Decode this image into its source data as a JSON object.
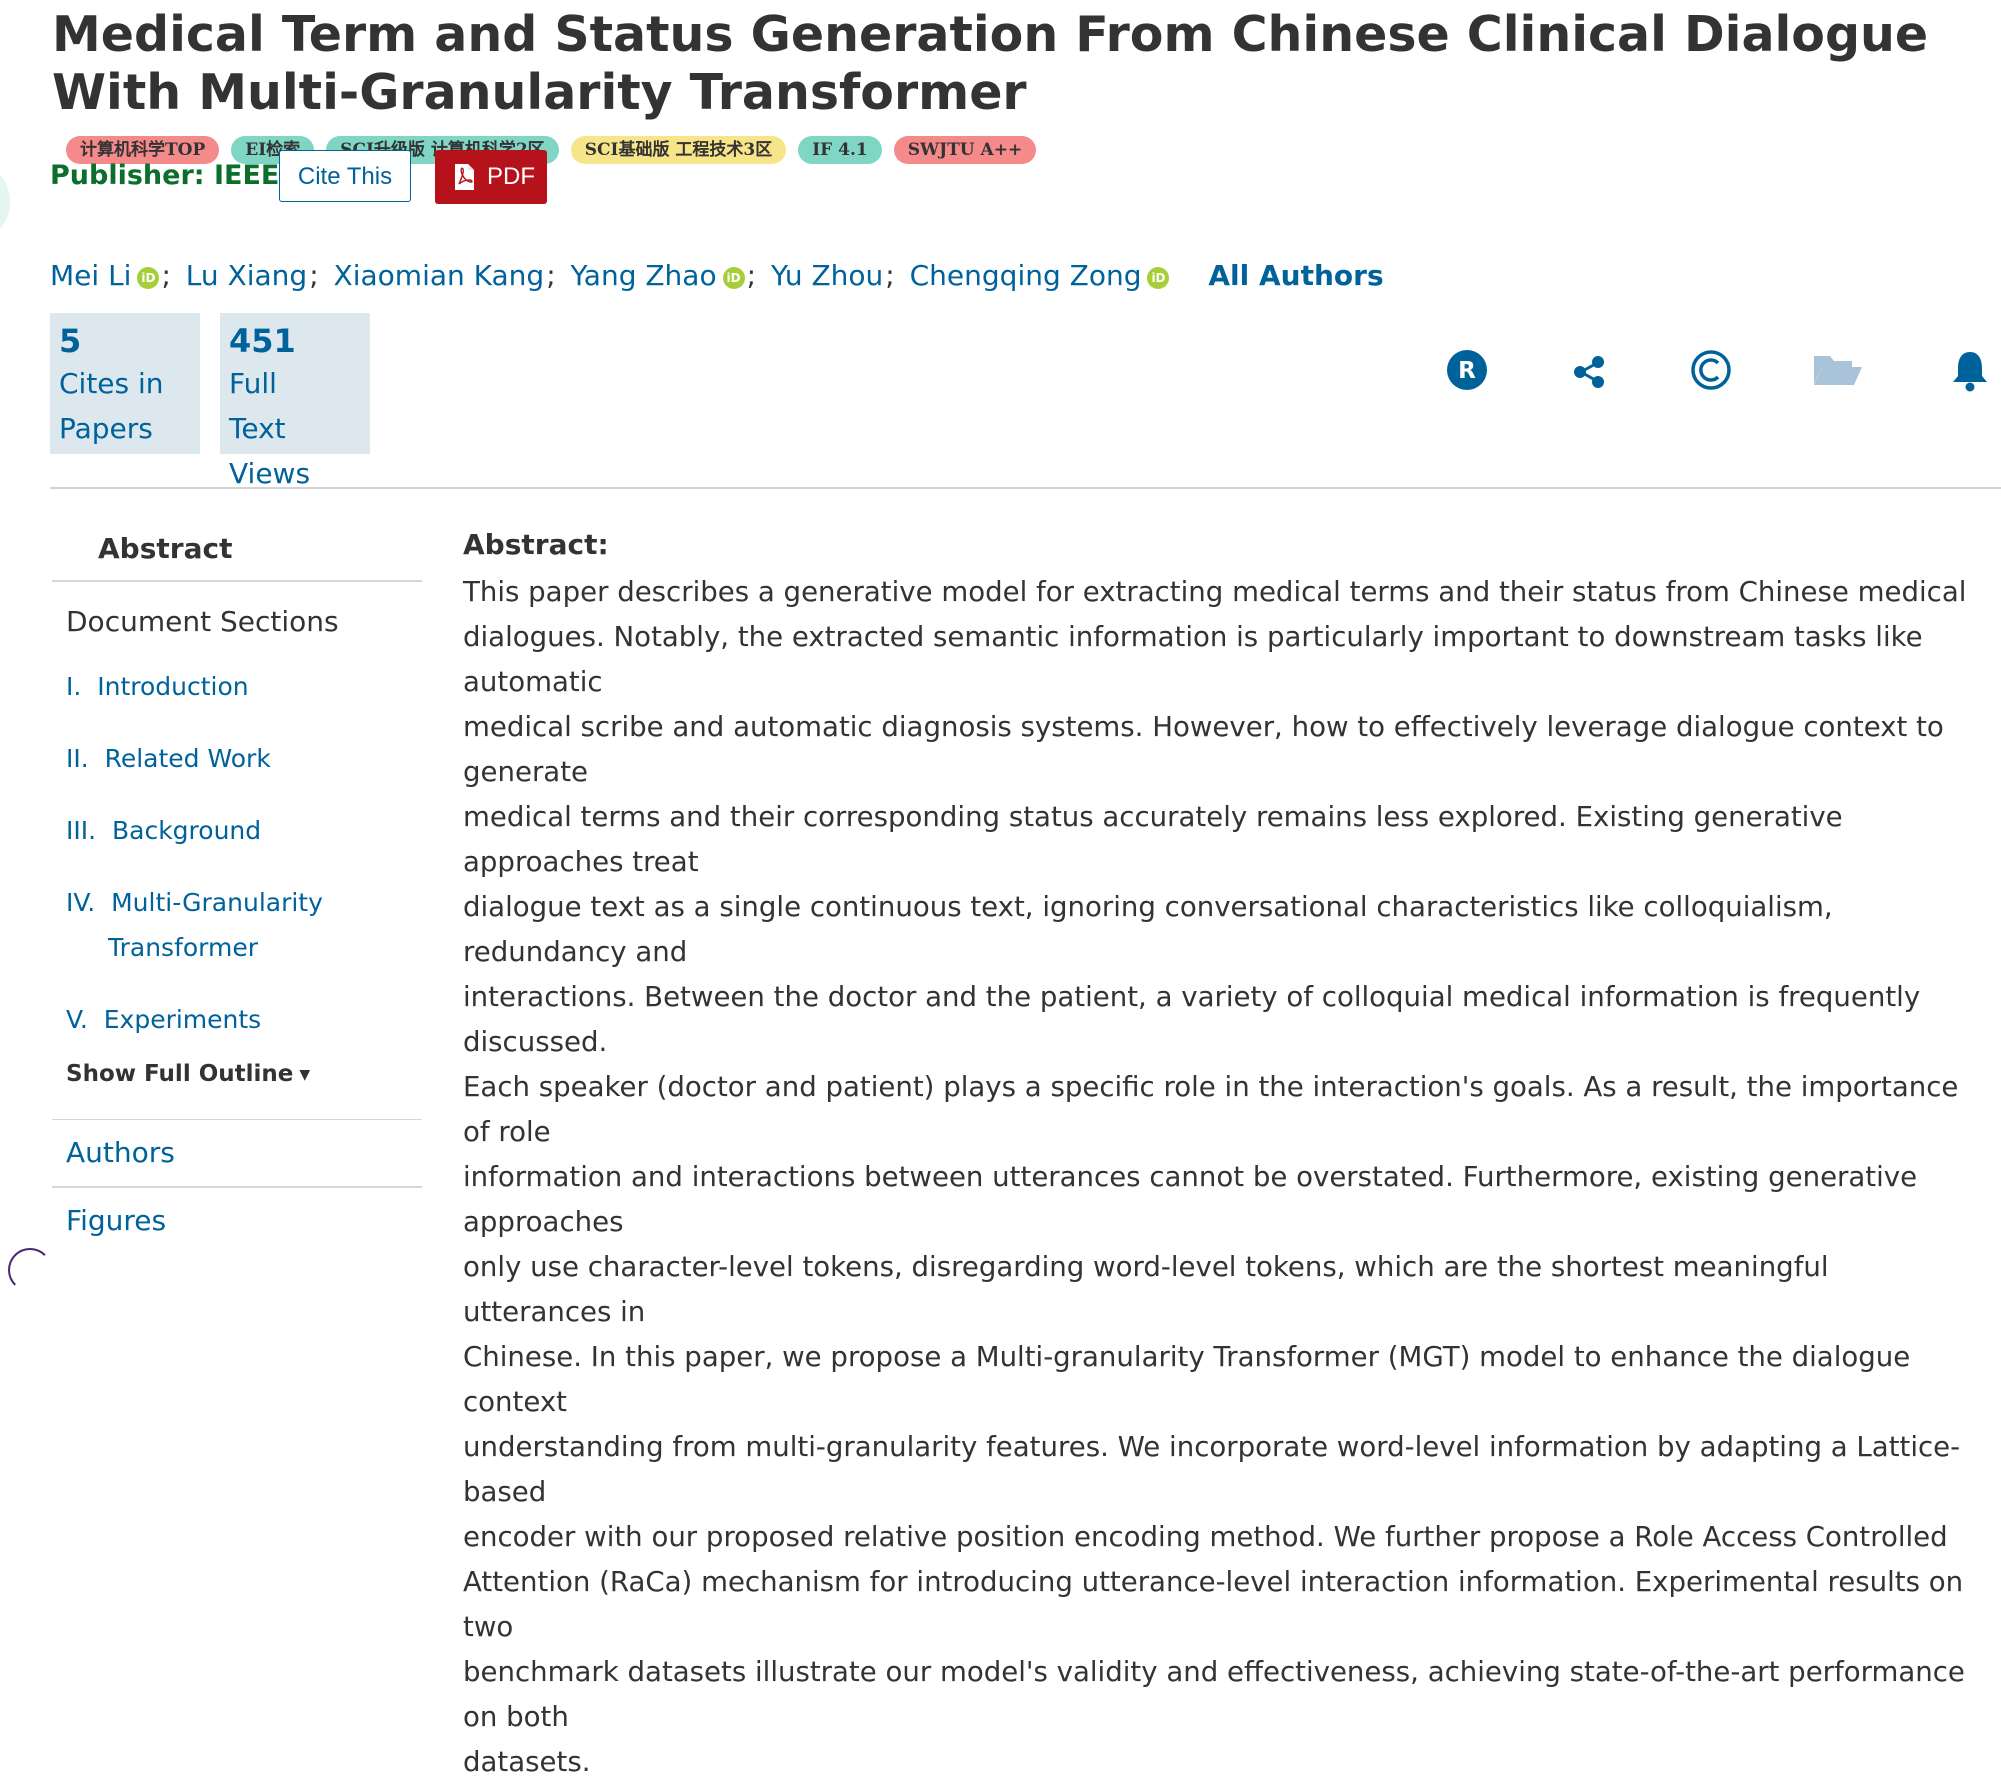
{
  "title": "Medical Term and Status Generation From Chinese Clinical Dialogue With Multi-Granularity Transformer",
  "badges": [
    {
      "label": "计算机科学TOP",
      "color": "#f58a8a"
    },
    {
      "label": "EI检索",
      "color": "#7fd6c5"
    },
    {
      "label": "SCI升级版 计算机科学2区",
      "color": "#7fd6c5"
    },
    {
      "label": "SCI基础版 工程技术3区",
      "color": "#f7e58a"
    },
    {
      "label": "IF 4.1",
      "color": "#7fd6c5"
    },
    {
      "label": "SWJTU A++",
      "color": "#f58a8a"
    }
  ],
  "publisher": "Publisher:  IEEE",
  "buttons": {
    "cite": "Cite This",
    "pdf": "PDF"
  },
  "authors": [
    {
      "name": "Mei Li",
      "orcid": true
    },
    {
      "name": "Lu Xiang",
      "orcid": false
    },
    {
      "name": "Xiaomian Kang",
      "orcid": false
    },
    {
      "name": "Yang Zhao",
      "orcid": true
    },
    {
      "name": "Yu Zhou",
      "orcid": false
    },
    {
      "name": "Chengqing Zong",
      "orcid": true
    }
  ],
  "author_separator": ";",
  "orcid_glyph": "iD",
  "all_authors": "All Authors",
  "metrics": {
    "cites_num": "5",
    "cites_label_1": "Cites in",
    "cites_label_2": "Papers",
    "views_num": "451",
    "views_label_1": "Full",
    "views_label_2": "Text",
    "views_label_3": "Views"
  },
  "tool_icons": [
    "rights-icon",
    "share-icon",
    "copyright-icon",
    "folder-icon",
    "bell-icon"
  ],
  "sidebar": {
    "abstract": "Abstract",
    "document_sections": "Document Sections",
    "sections": [
      {
        "num": "I.",
        "title": "Introduction"
      },
      {
        "num": "II.",
        "title": "Related Work"
      },
      {
        "num": "III.",
        "title": "Background"
      },
      {
        "num": "IV.",
        "title": "Multi-Granularity",
        "title2": "Transformer"
      },
      {
        "num": "V.",
        "title": "Experiments"
      }
    ],
    "show_full_outline": "Show Full Outline",
    "authors": "Authors",
    "figures": "Figures"
  },
  "abstract": {
    "label": "Abstract:",
    "lines": [
      "This paper describes a generative model for extracting medical terms and their status from Chinese medical",
      "dialogues. Notably, the extracted semantic information is particularly important to downstream tasks like automatic",
      "medical scribe and automatic diagnosis systems. However, how to effectively leverage dialogue context to generate",
      "medical terms and their corresponding status accurately remains less explored. Existing generative approaches treat",
      "dialogue text as a single continuous text, ignoring conversational characteristics like colloquialism, redundancy and",
      "interactions. Between the doctor and the patient, a variety of colloquial medical information is frequently discussed.",
      "Each speaker (doctor and patient) plays a specific role in the interaction's goals. As a result, the importance of role",
      "information and interactions between utterances cannot be overstated. Furthermore, existing generative approaches",
      "only use character-level tokens, disregarding word-level tokens, which are the shortest meaningful utterances in",
      "Chinese. In this paper, we propose a Multi-granularity Transformer (MGT) model to enhance the dialogue context",
      "understanding from multi-granularity features. We incorporate word-level information by adapting a Lattice-based",
      "encoder with our proposed relative position encoding method. We further propose a Role Access Controlled",
      "Attention (RaCa) mechanism for introducing utterance-level interaction information. Experimental results on two",
      "benchmark datasets illustrate our model's validity and effectiveness, achieving state-of-the-art performance on both",
      "datasets."
    ]
  },
  "colors": {
    "link": "#00629b",
    "publisher": "#0b6e2c",
    "pdf": "#b6121b",
    "metric_bg": "#dde7ee"
  }
}
